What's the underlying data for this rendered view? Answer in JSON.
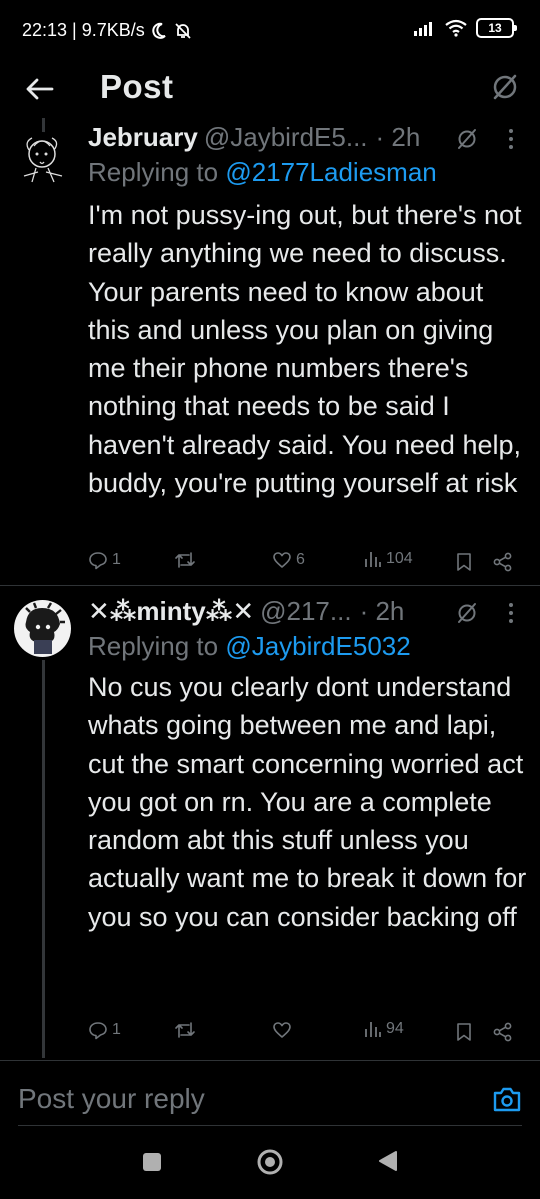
{
  "status_bar": {
    "time_speed": "22:13 | 9.7KB/s",
    "battery": "13"
  },
  "header": {
    "title": "Post"
  },
  "tweets": [
    {
      "display_name": "Jebruary",
      "handle": "@JaybirdE5...",
      "time": "· 2h",
      "replying_prefix": "Replying to ",
      "replying_to": "@2177Ladiesman",
      "body": "I'm not pussy-ing out, but there's not really anything we need to discuss. Your parents need to know about this and unless you plan on giving me their phone numbers there's nothing that needs to be said I haven't already said. You need help, buddy, you're putting yourself at risk",
      "replies": "1",
      "reposts": "",
      "likes": "6",
      "views": "104"
    },
    {
      "display_name": "✕⁂minty⁂✕",
      "handle": "@217...",
      "time": "· 2h",
      "replying_prefix": "Replying to ",
      "replying_to": "@JaybirdE5032",
      "body": "No cus you clearly dont understand whats going between me and lapi, cut the smart concerning worried act you got on rn. You are a complete random abt this stuff unless you actually want me to break it down for you so you can consider backing off",
      "replies": "1",
      "reposts": "",
      "likes": "",
      "views": "94"
    }
  ],
  "composer": {
    "placeholder": "Post your reply"
  },
  "colors": {
    "background": "#000000",
    "text": "#e7e9ea",
    "secondary": "#71767b",
    "accent": "#1d9bf0"
  },
  "icons": [
    "back-arrow-icon",
    "muted-icon",
    "reply-icon",
    "repost-icon",
    "like-icon",
    "views-icon",
    "bookmark-icon",
    "share-icon",
    "more-icon",
    "camera-icon",
    "nav-square-icon",
    "nav-home-icon",
    "nav-back-icon"
  ]
}
